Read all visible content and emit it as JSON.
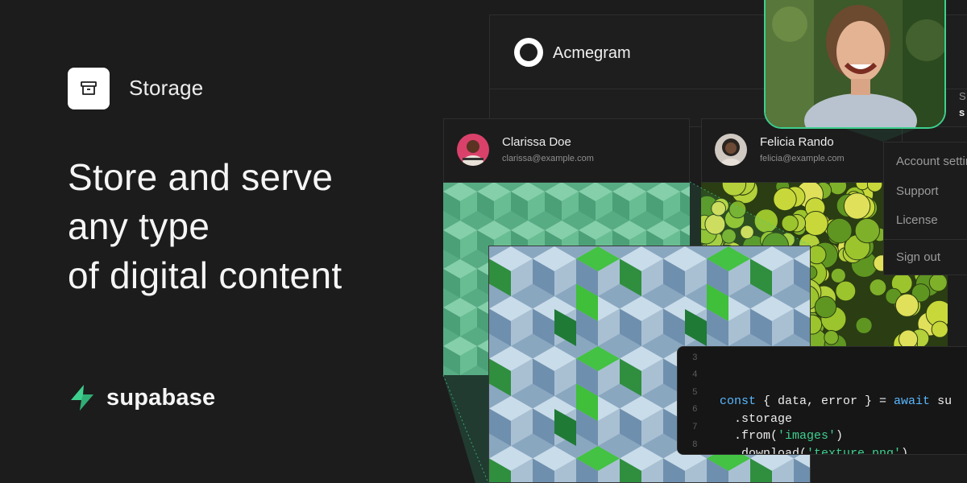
{
  "badge": {
    "label": "Storage",
    "icon": "archive-box-icon"
  },
  "headline": [
    "Store and serve",
    "any type",
    "of digital content"
  ],
  "brand": {
    "name": "supabase",
    "icon": "supabase-bolt-icon",
    "color": "#3ecf8e"
  },
  "app": {
    "name": "Acmegram",
    "logo": "ring-logo-icon"
  },
  "profiles": [
    {
      "name": "Clarissa Doe",
      "email": "clarissa@example.com"
    },
    {
      "name": "Felicia Rando",
      "email": "felicia@example.com"
    }
  ],
  "menu": {
    "items": [
      "Account settings",
      "Support",
      "License",
      "Sign out"
    ]
  },
  "side_peek": {
    "line1": "S",
    "line2": "s"
  },
  "code": {
    "lines": [
      {
        "num": "3",
        "text": ""
      },
      {
        "num": "4",
        "text": "const { data, error } = await su"
      },
      {
        "num": "5",
        "text": "  .storage"
      },
      {
        "num": "6",
        "text": "  .from('images')"
      },
      {
        "num": "7",
        "text": "  .download('texture.png')"
      },
      {
        "num": "8",
        "text": ""
      }
    ]
  },
  "colors": {
    "background": "#1c1c1c",
    "accent": "#3ecf8e",
    "keyword": "#59b8ff"
  }
}
